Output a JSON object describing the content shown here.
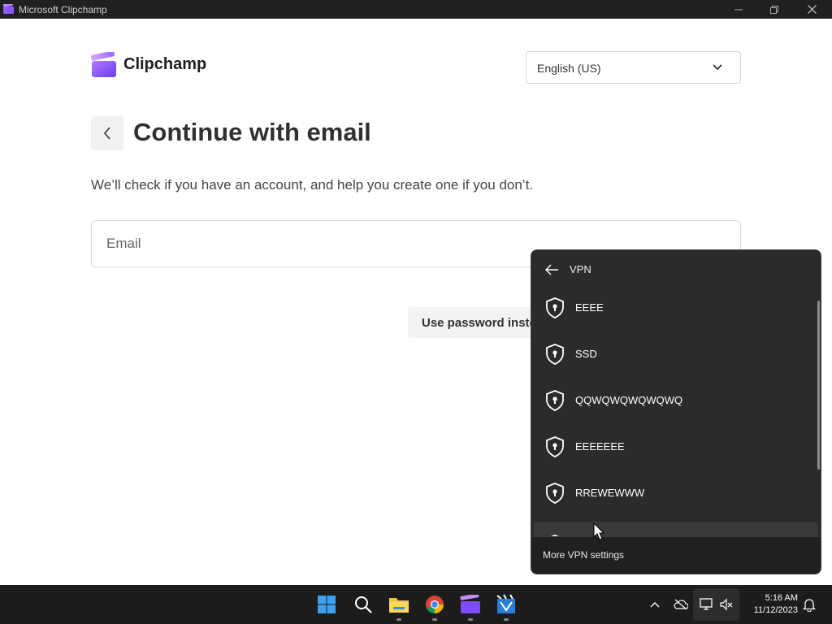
{
  "window": {
    "title": "Microsoft Clipchamp"
  },
  "app": {
    "logo_text": "Clipchamp",
    "language": {
      "selected": "English (US)"
    },
    "page_title": "Continue with email",
    "subtitle": "We’ll check if you have an account, and help you create one if you don’t.",
    "email": {
      "placeholder": "Email",
      "value": ""
    },
    "use_password_label": "Use password instead"
  },
  "vpn_flyout": {
    "title": "VPN",
    "connections": [
      {
        "name": "EEEE"
      },
      {
        "name": "SSD"
      },
      {
        "name": "QQWQWQWQWQWQ"
      },
      {
        "name": "EEEEEEE"
      },
      {
        "name": "RREWEWWW"
      },
      {
        "name": ""
      }
    ],
    "more_settings_label": "More VPN settings"
  },
  "taskbar": {
    "apps": [
      "windows-start",
      "search",
      "file-explorer",
      "chrome",
      "clipchamp",
      "movie-maker"
    ],
    "clock": {
      "time": "5:16 AM",
      "date": "11/12/2023"
    }
  },
  "colors": {
    "accent_purple": "#7c4dff",
    "flyout_bg": "#2b2b2b",
    "taskbar_bg": "#1c1c1c"
  }
}
